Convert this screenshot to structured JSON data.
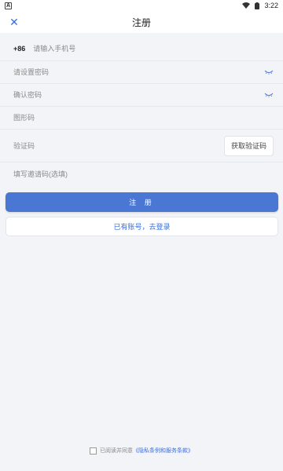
{
  "status_bar": {
    "notification_letter": "A",
    "time": "3:22"
  },
  "header": {
    "close_glyph": "✕",
    "title": "注册"
  },
  "form": {
    "phone_prefix": "+86",
    "phone_placeholder": "请输入手机号",
    "password_placeholder": "请设置密码",
    "confirm_placeholder": "确认密码",
    "captcha_placeholder": "图形码",
    "sms_placeholder": "验证码",
    "get_code_label": "获取验证码",
    "invite_placeholder": "填写邀请码(选填)"
  },
  "buttons": {
    "register_label": "注 册",
    "login_label": "已有账号，去登录"
  },
  "agreement": {
    "text": "已阅读并同意",
    "link": "《隐私条例和服务条款》"
  },
  "colors": {
    "accent": "#4a76d4",
    "link": "#3a6fd8",
    "background": "#f3f4f8"
  },
  "icons": [
    "close-icon",
    "eye-closed-icon",
    "wifi-icon",
    "battery-icon"
  ]
}
